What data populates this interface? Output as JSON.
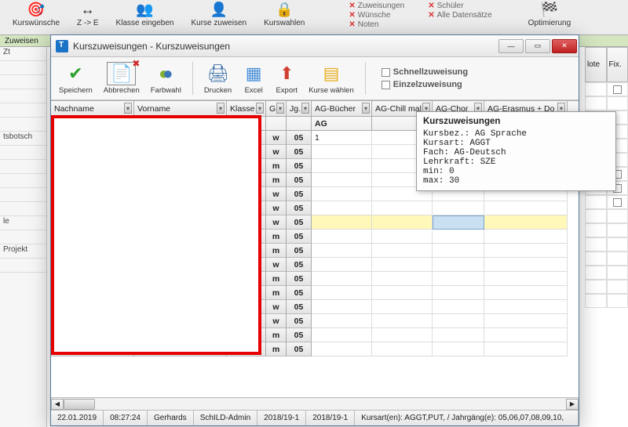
{
  "bg_ribbon": [
    {
      "icon": "🎯",
      "label": "Kurswünsche"
    },
    {
      "icon": "↔",
      "label": "Z -> E"
    },
    {
      "icon": "👥",
      "label": "Klasse eingeben"
    },
    {
      "icon": "👤",
      "label": "Kurse zuweisen"
    },
    {
      "icon": "🔒",
      "label": "Kurswahlen"
    }
  ],
  "bg_ribbon_opt": {
    "icon": "🏁",
    "label": "Optimierung"
  },
  "bg_strikes_col1": [
    "Zuweisungen",
    "Wünsche",
    "Noten"
  ],
  "bg_strikes_col2": [
    "Schüler",
    "Alle Datensätze"
  ],
  "bg_tab": "Zuweisen",
  "bg_sidebar_rows": [
    "Zt",
    "",
    "",
    "",
    "",
    "",
    "tsbotsch",
    "",
    "",
    "",
    "",
    "",
    "le",
    "",
    "Projekt",
    ""
  ],
  "bg_right_headers": [
    "lote",
    "Fix."
  ],
  "dialog_title": "Kurszuweisungen - Kurszuweisungen",
  "dialog_buttons": [
    {
      "key": "speichern",
      "icon": "✔",
      "color": "#2ca02c",
      "label": "Speichern"
    },
    {
      "key": "abbrechen",
      "icon": "✖",
      "color": "#d02828",
      "label": "Abbrechen",
      "box": true
    },
    {
      "key": "farbwahl",
      "icon": "◑",
      "color": "#84b030",
      "label": "Farbwahl"
    },
    {
      "sep": true
    },
    {
      "key": "drucken",
      "icon": "🖨",
      "color": "#3a6fa8",
      "label": "Drucken"
    },
    {
      "key": "excel",
      "icon": "▦",
      "color": "#4a90d9",
      "label": "Excel"
    },
    {
      "key": "export",
      "icon": "⬆",
      "color": "#d04030",
      "label": "Export"
    },
    {
      "key": "kurse",
      "icon": "▤",
      "color": "#e8b020",
      "label": "Kurse wählen"
    }
  ],
  "dialog_checks": [
    "Schnellzuweisung",
    "Einzelzuweisung"
  ],
  "grid_headers": [
    {
      "cls": "c-nach",
      "label": "Nachname"
    },
    {
      "cls": "c-vor",
      "label": "Vorname"
    },
    {
      "cls": "c-kl",
      "label": "Klasse"
    },
    {
      "cls": "c-g",
      "label": "G."
    },
    {
      "cls": "c-jg",
      "label": "Jg."
    },
    {
      "cls": "c-ag1",
      "label": "AG-Bücher"
    },
    {
      "cls": "c-ag2",
      "label": "AG-Chill mal"
    },
    {
      "cls": "c-ag3",
      "label": "AG-Chor"
    },
    {
      "cls": "c-ag4",
      "label": "AG-Erasmus + Do"
    }
  ],
  "grid_subhead": {
    "ag": "AG",
    "first": "1"
  },
  "grid_rows": [
    {
      "g": "w",
      "jg": "05"
    },
    {
      "g": "w",
      "jg": "05"
    },
    {
      "g": "m",
      "jg": "05"
    },
    {
      "g": "m",
      "jg": "05"
    },
    {
      "g": "w",
      "jg": "05"
    },
    {
      "g": "w",
      "jg": "05"
    },
    {
      "g": "w",
      "jg": "05",
      "hl": true
    },
    {
      "g": "m",
      "jg": "05"
    },
    {
      "g": "m",
      "jg": "05"
    },
    {
      "g": "w",
      "jg": "05"
    },
    {
      "g": "m",
      "jg": "05"
    },
    {
      "g": "m",
      "jg": "05"
    },
    {
      "g": "w",
      "jg": "05"
    },
    {
      "g": "w",
      "jg": "05"
    },
    {
      "g": "m",
      "jg": "05"
    },
    {
      "g": "m",
      "jg": "05"
    }
  ],
  "tooltip": {
    "title": "Kurszuweisungen",
    "lines": [
      "Kursbez.: AG Sprache",
      "Kursart: AGGT",
      "Fach: AG-Deutsch",
      "Lehrkraft: SZE",
      "min: 0",
      "max: 30"
    ]
  },
  "status": {
    "date": "22.01.2019",
    "time": "08:27:24",
    "user": "Gerhards",
    "role": "SchILD-Admin",
    "y1": "2018/19-1",
    "y2": "2018/19-1",
    "long": "Kursart(en): AGGT,PUT, / Jahrgäng(e): 05,06,07,08,09,10,"
  },
  "winbtns": {
    "min": "—",
    "max": "▭",
    "close": "✕"
  }
}
